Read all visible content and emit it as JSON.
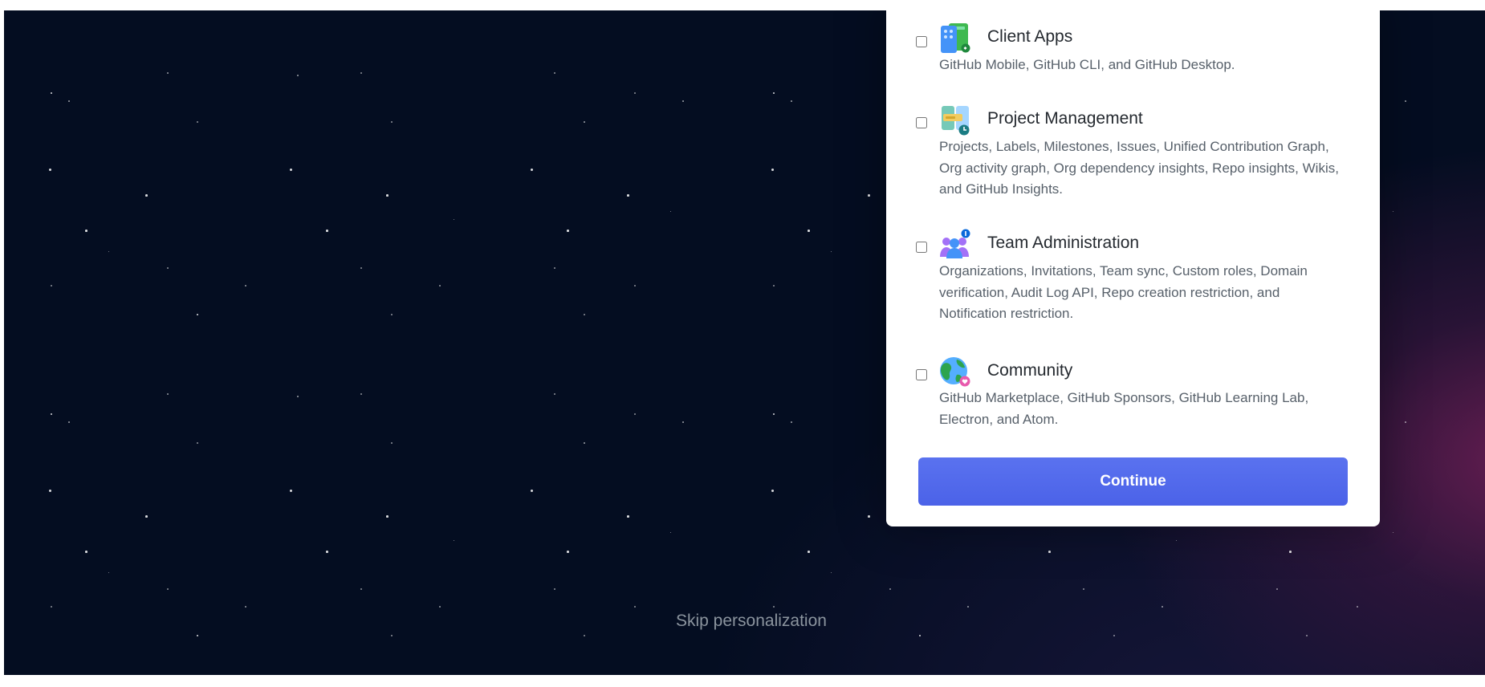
{
  "options": [
    {
      "title": "Client Apps",
      "description": "GitHub Mobile, GitHub CLI, and GitHub Desktop.",
      "icon": "client-apps-icon",
      "checked": false
    },
    {
      "title": "Project Management",
      "description": "Projects, Labels, Milestones, Issues, Unified Contribution Graph, Org activity graph, Org dependency insights, Repo insights, Wikis, and GitHub Insights.",
      "icon": "project-management-icon",
      "checked": false
    },
    {
      "title": "Team Administration",
      "description": "Organizations, Invitations, Team sync, Custom roles, Domain verification, Audit Log API, Repo creation restriction, and Notification restriction.",
      "icon": "team-administration-icon",
      "checked": false
    },
    {
      "title": "Community",
      "description": "GitHub Marketplace, GitHub Sponsors, GitHub Learning Lab, Electron, and Atom.",
      "icon": "community-icon",
      "checked": false
    }
  ],
  "continue_label": "Continue",
  "skip_label": "Skip personalization",
  "colors": {
    "background": "#040d21",
    "card": "#ffffff",
    "button": "#5468ea",
    "title_text": "#24292f",
    "description_text": "#57606a",
    "skip_text": "#8b949e"
  }
}
